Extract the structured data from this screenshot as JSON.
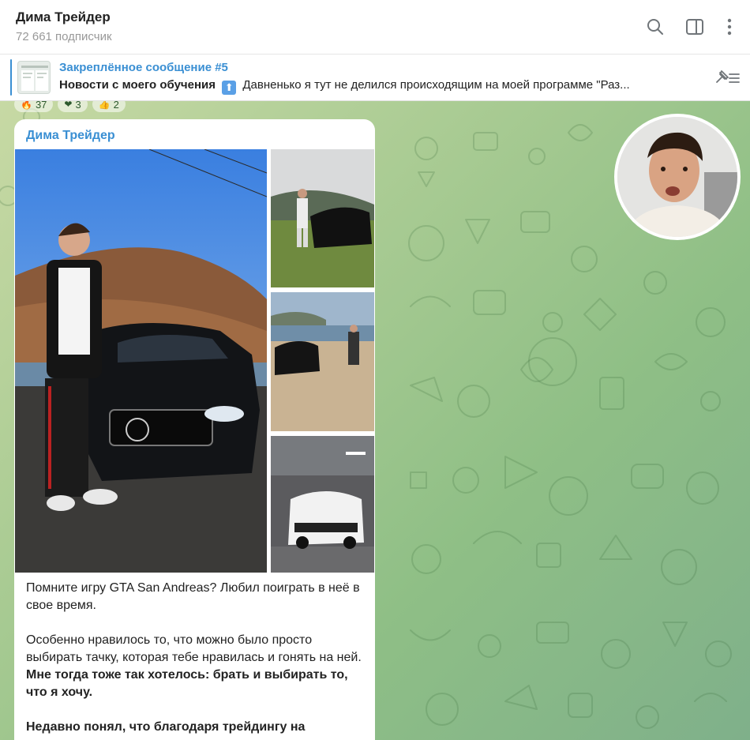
{
  "header": {
    "title": "Дима Трейдер",
    "subscribers": "72 661 подписчик",
    "icons": [
      "search-icon",
      "sidebar-toggle-icon",
      "more-vertical-icon"
    ]
  },
  "pinned": {
    "title": "Закреплённое сообщение #5",
    "bold": "Новости с моего обучения",
    "emoji": "⬆",
    "text": "Давненько я тут не делился происходящим на моей программе \"Раз..."
  },
  "reactions": [
    {
      "emoji": "🔥",
      "count": "37"
    },
    {
      "emoji": "❤",
      "count": "3"
    },
    {
      "emoji": "👍",
      "count": "2"
    }
  ],
  "message": {
    "author": "Дима Трейдер",
    "p1": "Помните игру GTA San Andreas? Любил поиграть в неё в свое время.",
    "p2_plain": "Особенно нравилось то, что можно было просто выбирать тачку, которая тебе нравилась и гонять на ней. ",
    "p2_bold": "Мне тогда тоже так хотелось: брать и выбирать то, что я хочу.",
    "p3_bold": "Недавно понял, что благодаря трейдингу на"
  },
  "colors": {
    "accent": "#3a8fd3",
    "chat_bg": "#a9cb93"
  }
}
